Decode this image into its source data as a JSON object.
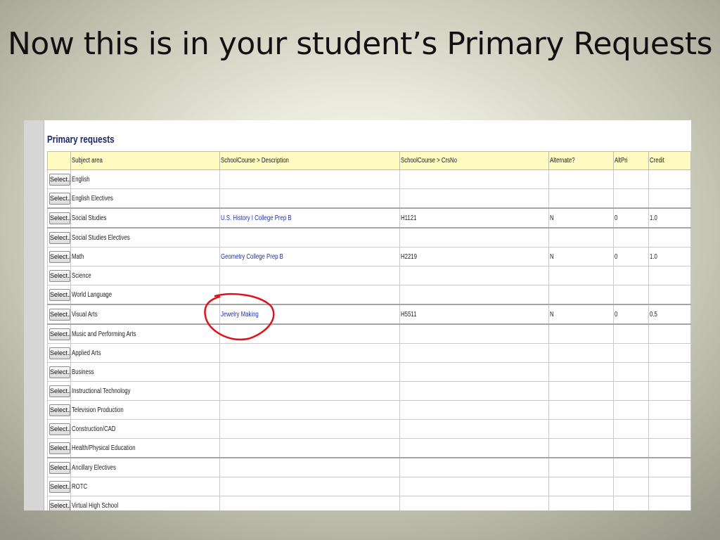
{
  "slide": {
    "title": "Now this is in your student’s Primary Requests"
  },
  "panel": {
    "title": "Primary requests",
    "columns": [
      "",
      "Subject area",
      "SchoolCourse > Description",
      "SchoolCourse > CrsNo",
      "Alternate?",
      "AltPri",
      "Credit"
    ],
    "select_label": "Select...",
    "rows": [
      {
        "subject": "English",
        "description": "",
        "crsno": "",
        "alternate": "",
        "altpri": "",
        "credit": ""
      },
      {
        "subject": "English Electives",
        "description": "",
        "crsno": "",
        "alternate": "",
        "altpri": "",
        "credit": ""
      },
      {
        "subject": "Social Studies",
        "description": "U.S. History I College Prep B",
        "crsno": "H1121",
        "alternate": "N",
        "altpri": "0",
        "credit": "1.0"
      },
      {
        "subject": "Social Studies Electives",
        "description": "",
        "crsno": "",
        "alternate": "",
        "altpri": "",
        "credit": ""
      },
      {
        "subject": "Math",
        "description": "Geometry College Prep B",
        "crsno": "H2219",
        "alternate": "N",
        "altpri": "0",
        "credit": "1.0"
      },
      {
        "subject": "Science",
        "description": "",
        "crsno": "",
        "alternate": "",
        "altpri": "",
        "credit": ""
      },
      {
        "subject": "World Language",
        "description": "",
        "crsno": "",
        "alternate": "",
        "altpri": "",
        "credit": ""
      },
      {
        "subject": "Visual Arts",
        "description": "Jewelry Making",
        "crsno": "H5511",
        "alternate": "N",
        "altpri": "0",
        "credit": "0.5"
      },
      {
        "subject": "Music and Performing Arts",
        "description": "",
        "crsno": "",
        "alternate": "",
        "altpri": "",
        "credit": ""
      },
      {
        "subject": "Applied Arts",
        "description": "",
        "crsno": "",
        "alternate": "",
        "altpri": "",
        "credit": ""
      },
      {
        "subject": "Business",
        "description": "",
        "crsno": "",
        "alternate": "",
        "altpri": "",
        "credit": ""
      },
      {
        "subject": "Instructional Technology",
        "description": "",
        "crsno": "",
        "alternate": "",
        "altpri": "",
        "credit": ""
      },
      {
        "subject": "Television Production",
        "description": "",
        "crsno": "",
        "alternate": "",
        "altpri": "",
        "credit": ""
      },
      {
        "subject": "Construction/CAD",
        "description": "",
        "crsno": "",
        "alternate": "",
        "altpri": "",
        "credit": ""
      },
      {
        "subject": "Health/Physical Education",
        "description": "",
        "crsno": "",
        "alternate": "",
        "altpri": "",
        "credit": ""
      },
      {
        "subject": "Ancillary Electives",
        "description": "",
        "crsno": "",
        "alternate": "",
        "altpri": "",
        "credit": ""
      },
      {
        "subject": "ROTC",
        "description": "",
        "crsno": "",
        "alternate": "",
        "altpri": "",
        "credit": ""
      },
      {
        "subject": "Virtual High School",
        "description": "",
        "crsno": "",
        "alternate": "",
        "altpri": "",
        "credit": ""
      }
    ]
  },
  "colors": {
    "header_bg": "#fffbc0",
    "link": "#1f2fa8",
    "annotation": "#e0101c",
    "panel_title": "#1c2a63"
  }
}
